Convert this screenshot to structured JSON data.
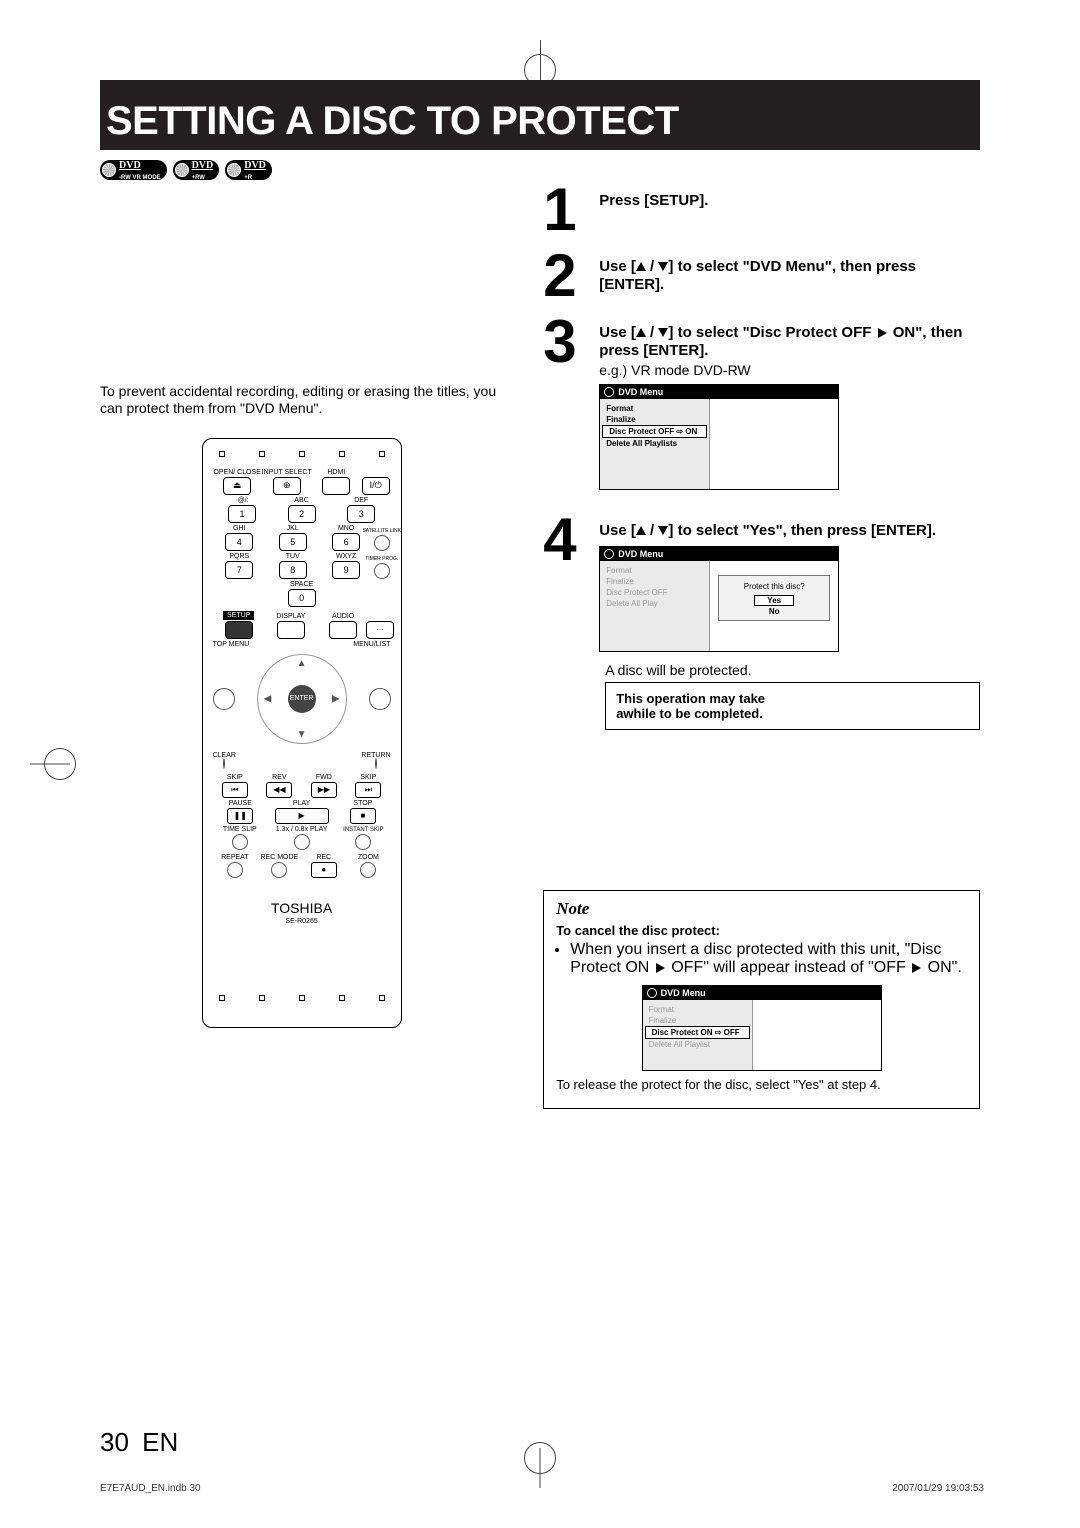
{
  "title": "SETTING A DISC TO PROTECT",
  "disc_badges": [
    "DVD -RW VR MODE",
    "DVD +RW",
    "DVD +R"
  ],
  "intro": "To prevent accidental recording, editing or erasing the titles, you can protect them from \"DVD Menu\".",
  "steps": {
    "s1": {
      "num": "1",
      "lead": "Press [SETUP]."
    },
    "s2": {
      "num": "2",
      "lead_a": "Use [",
      "lead_b": " / ",
      "lead_c": "] to select \"DVD Menu\", then press [ENTER]."
    },
    "s3": {
      "num": "3",
      "lead_a": "Use [",
      "lead_b": " / ",
      "lead_c": "] to select \"Disc Protect OFF ",
      "lead_d": " ON\", then press [ENTER].",
      "sub": "e.g.) VR mode DVD-RW"
    },
    "s4": {
      "num": "4",
      "lead_a": "Use [",
      "lead_b": " / ",
      "lead_c": "] to select \"Yes\", then press [ENTER].",
      "caption": "A disc will be protected.",
      "note_a": "This operation may take",
      "note_b": "awhile to be completed."
    }
  },
  "menu3": {
    "title": "DVD Menu",
    "items": [
      "Format",
      "Finalize",
      "Disc Protect OFF ⇨ ON",
      "Delete All Playlists"
    ],
    "highlight_index": 2
  },
  "menu4": {
    "title": "DVD Menu",
    "items": [
      "Format",
      "Finalize",
      "Disc Protect OFF",
      "Delete All Play"
    ],
    "popup": {
      "q": "Protect this disc?",
      "yes": "Yes",
      "no": "No"
    }
  },
  "bottom_note": {
    "heading": "Note",
    "subhead": "To cancel the disc protect:",
    "bullet1a": "When you insert a disc protected with this unit, \"Disc Protect ON ",
    "bullet1b": " OFF\" will appear instead of \"OFF ",
    "bullet1c": " ON\".",
    "menu": {
      "title": "DVD Menu",
      "items": [
        "Format",
        "Finalize",
        "Disc Protect ON ⇨ OFF",
        "Delete All Playlist"
      ],
      "highlight_index": 2
    },
    "tail": "To release the protect for the disc, select \"Yes\" at step 4."
  },
  "remote": {
    "brand": "TOSHIBA",
    "model": "SE-R0265",
    "labels": {
      "open": "OPEN/\nCLOSE",
      "input": "INPUT\nSELECT",
      "hdmi": "HDMI",
      "power": "I/⏻",
      "sym": "·@/:",
      "abc": "ABC",
      "def": "DEF",
      "ghi": "GHI",
      "jkl": "JKL",
      "mno": "MNO",
      "pqrs": "PQRS",
      "tuv": "TUV",
      "wxyz": "WXYZ",
      "sat": "SATELLITE\nLINK",
      "space": "SPACE",
      "timer": "TIMER\nPROG.",
      "setup": "SETUP",
      "display": "DISPLAY",
      "audio": "AUDIO",
      "topmenu": "TOP MENU",
      "menulist": "MENU/LIST",
      "enter": "ENTER",
      "clear": "CLEAR",
      "return": "RETURN",
      "skipL": "SKIP",
      "rev": "REV",
      "fwd": "FWD",
      "skipR": "SKIP",
      "pause": "PAUSE",
      "play": "PLAY",
      "stop": "STOP",
      "timeslip": "TIME SLIP",
      "xplay": "1.3x / 0.8x PLAY",
      "instskip": "INSTANT SKIP",
      "repeat": "REPEAT",
      "recmode": "REC MODE",
      "rec": "REC",
      "zoom": "ZOOM"
    },
    "keys": {
      "1": "1",
      "2": "2",
      "3": "3",
      "4": "4",
      "5": "5",
      "6": "6",
      "7": "7",
      "8": "8",
      "9": "9",
      "0": "0"
    },
    "media": {
      "skipL": "⏮",
      "rev": "◀◀",
      "fwd": "▶▶",
      "skipR": "⏭",
      "pause": "❚❚",
      "play": "▶",
      "stop": "■",
      "rec": "●"
    }
  },
  "page_number": "30",
  "page_lang": "EN",
  "footer_left": "E7E7AUD_EN.indb   30",
  "footer_right": "2007/01/29   19:03:53"
}
